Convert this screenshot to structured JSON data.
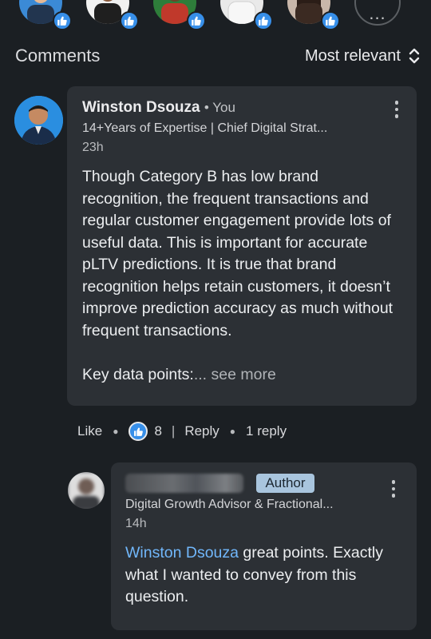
{
  "reactors": {
    "avatar_colors": [
      "#3b8ad6",
      "#f1f1f1",
      "#2e7d3a",
      "#e9e9e9",
      "#c9b7aa"
    ],
    "more_label": "..."
  },
  "comments_header": {
    "title": "Comments",
    "sort_label": "Most relevant"
  },
  "comment": {
    "author": "Winston Dsouza",
    "you_label": "• You",
    "headline": "14+Years of Expertise | Chief Digital Strat...",
    "time": "23h",
    "body": "Though Category B has low brand recognition, the frequent transactions and regular customer engagement provide lots of useful data. This is important for accurate pLTV predictions. It is true that brand recognition helps retain customers, it doesn’t improve prediction accuracy as much without frequent transactions.\n\nKey data points:",
    "see_more": "... see more",
    "actions": {
      "like": "Like",
      "like_count": "8",
      "separator": "|",
      "reply": "Reply",
      "replies": "1 reply"
    }
  },
  "reply": {
    "author_badge": "Author",
    "headline": "Digital Growth Advisor & Fractional...",
    "time": "14h",
    "mention": "Winston Dsouza",
    "text": " great points. Exactly what I wanted to convey from this question."
  },
  "colors": {
    "background": "#1b1f23",
    "bubble": "#2c3035",
    "like_blue": "#378fe9",
    "mention": "#71b7fb",
    "author_badge": "#a9c5de"
  }
}
